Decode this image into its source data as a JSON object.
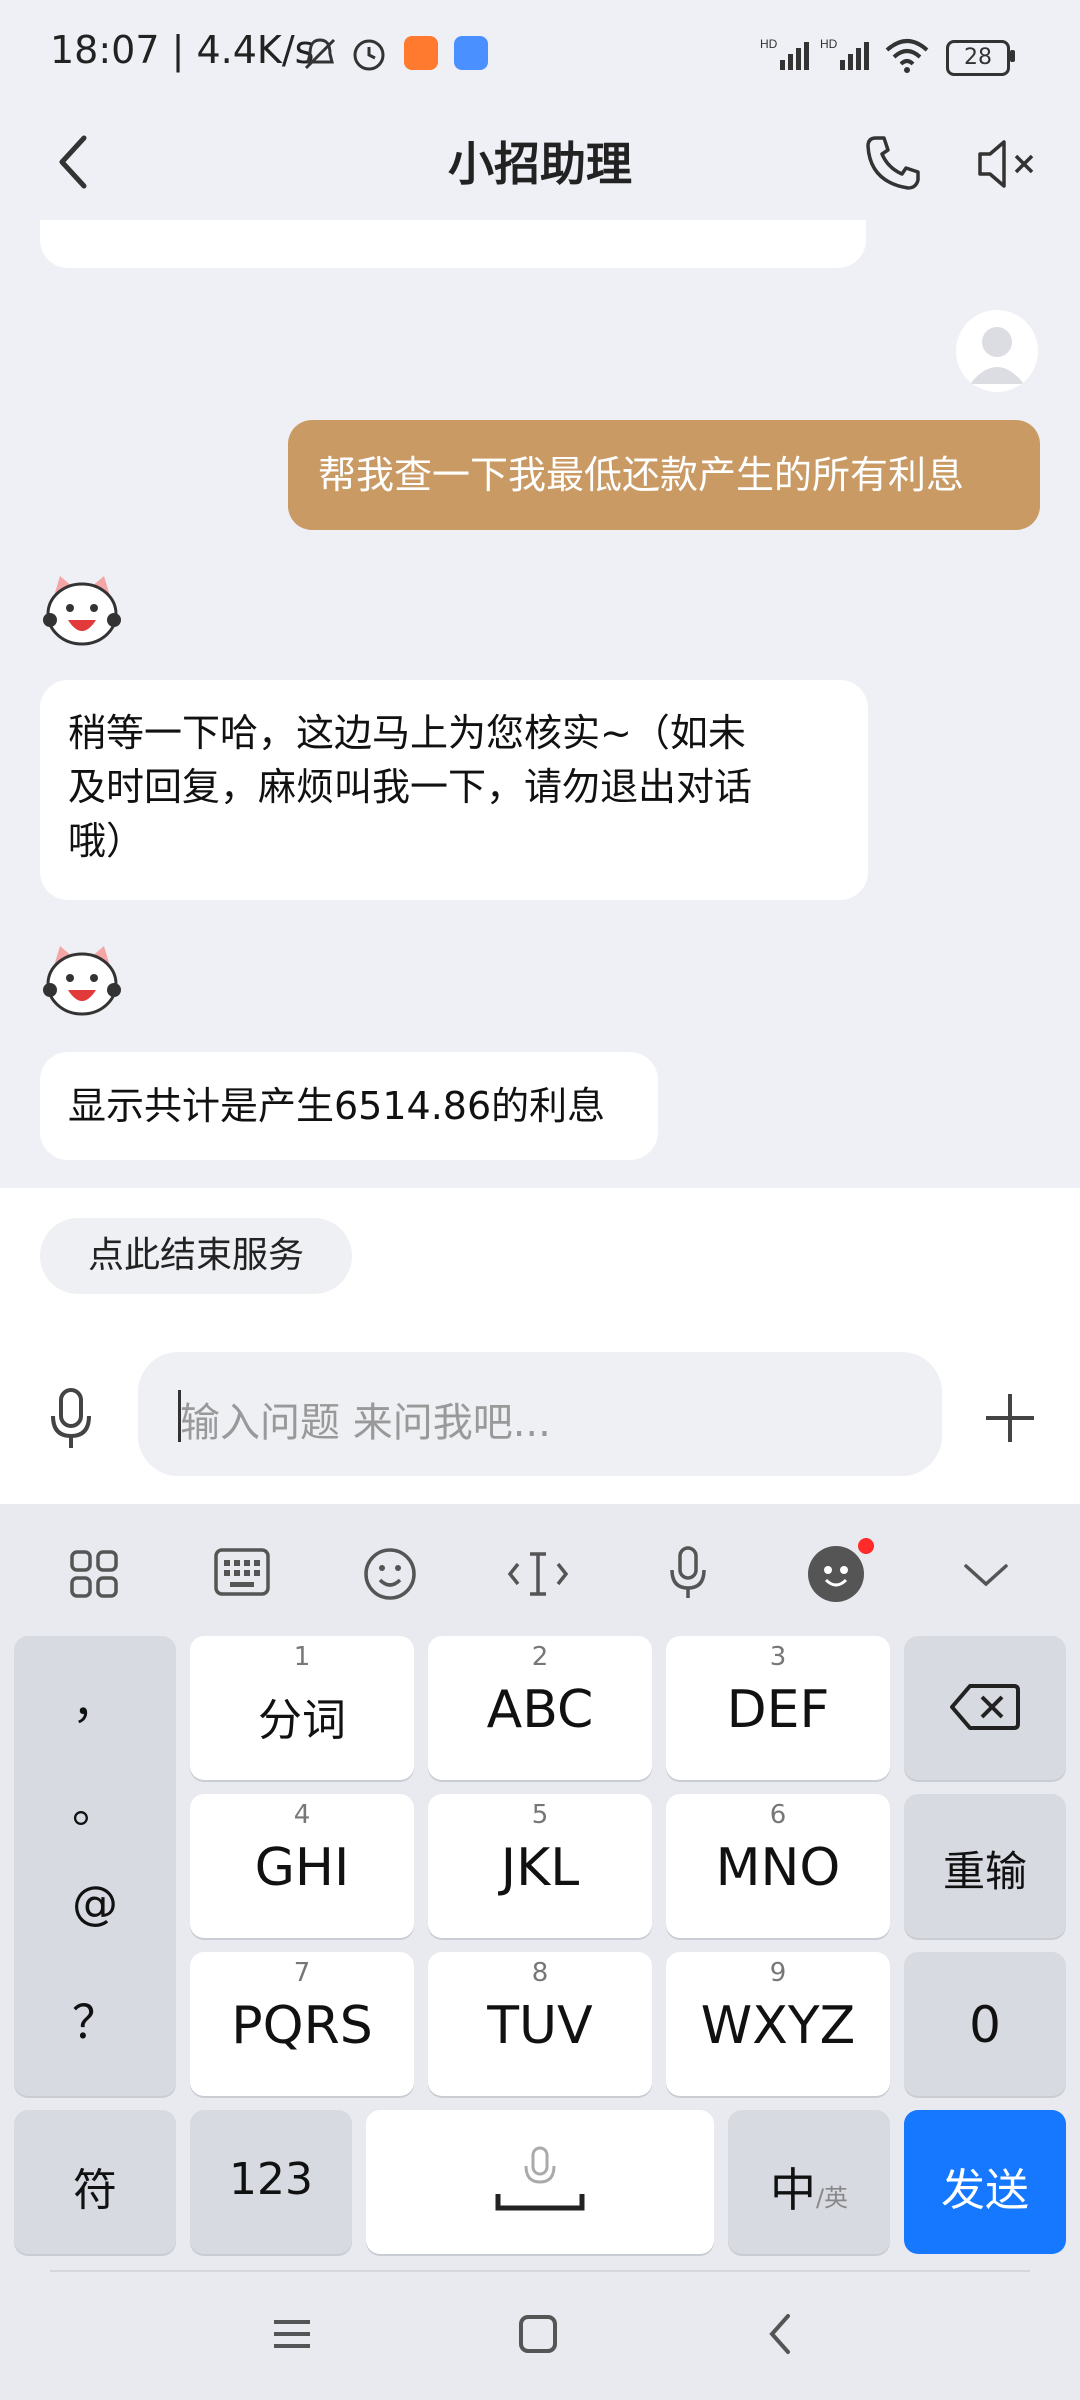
{
  "status_bar": {
    "time": "18:07",
    "speed": "4.4K/s",
    "battery": "28",
    "icons": [
      "mute-icon",
      "alarm-icon",
      "app-icon-orange",
      "app-icon-blue",
      "signal-hd-icon",
      "signal-hd-icon",
      "wifi-icon",
      "battery-icon"
    ]
  },
  "header": {
    "title": "小招助理",
    "back_icon": "chevron-left-icon",
    "call_icon": "phone-icon",
    "mute_icon": "speaker-mute-icon"
  },
  "chat": {
    "user_message": "帮我查一下我最低还款产生的所有利息",
    "bot_messages": [
      [
        "稍等一下哈，这边马上为您核实~（如未",
        "及时回复，麻烦叫我一下，请勿退出对话",
        "哦）"
      ],
      [
        "显示共计是产生6514.86的利息"
      ]
    ]
  },
  "service": {
    "end_button": "点此结束服务",
    "input_placeholder": "输入问题 来问我吧...",
    "colors": {
      "user_bubble": "#c99a64",
      "send_button": "#1677ff"
    }
  },
  "keyboard": {
    "left_column": [
      "，",
      "。",
      "@",
      "？"
    ],
    "keys": [
      {
        "num": "1",
        "label": "分词"
      },
      {
        "num": "2",
        "label": "ABC"
      },
      {
        "num": "3",
        "label": "DEF"
      },
      {
        "num": "4",
        "label": "GHI"
      },
      {
        "num": "5",
        "label": "JKL"
      },
      {
        "num": "6",
        "label": "MNO"
      },
      {
        "num": "7",
        "label": "PQRS"
      },
      {
        "num": "8",
        "label": "TUV"
      },
      {
        "num": "9",
        "label": "WXYZ"
      }
    ],
    "reinput": "重输",
    "zero": "0",
    "symbol": "符",
    "num_switch": "123",
    "lang_main": "中",
    "lang_sub": "/英",
    "send": "发送"
  }
}
